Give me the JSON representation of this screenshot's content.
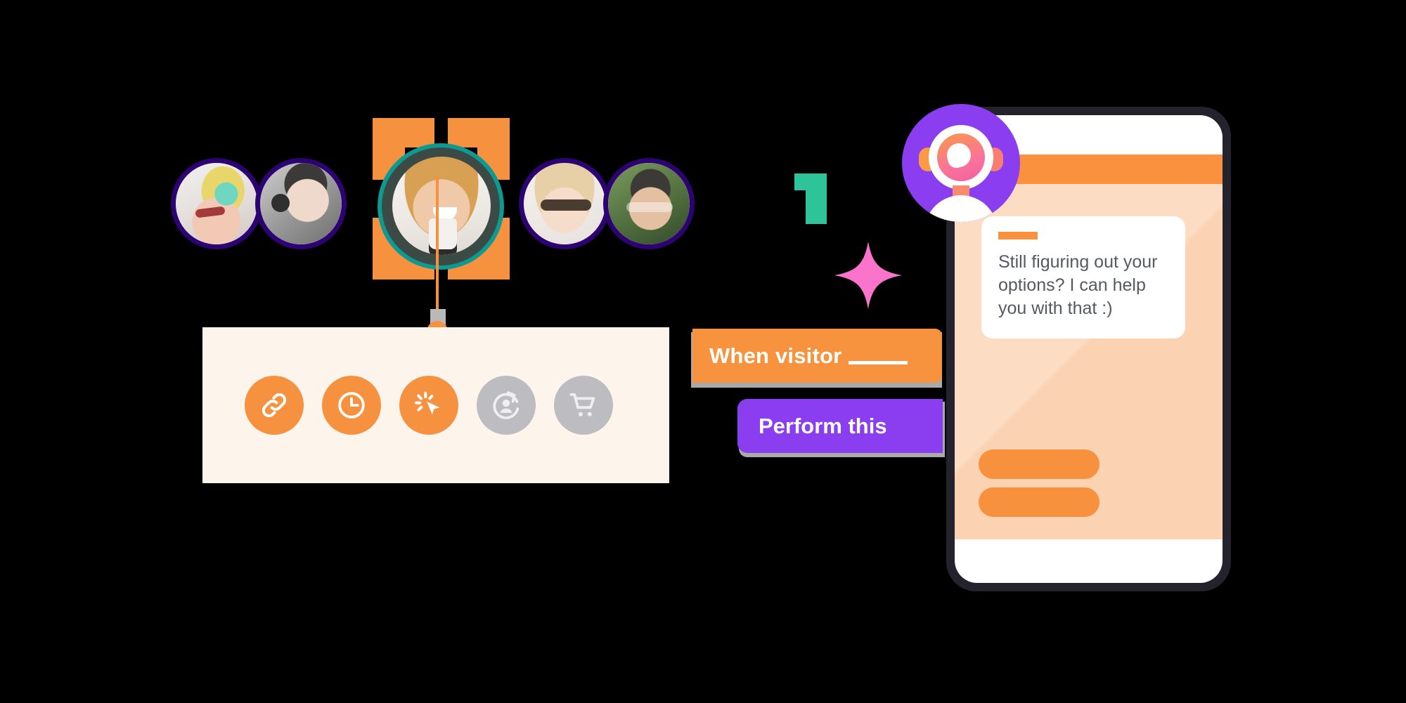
{
  "theme": {
    "background": "#000000",
    "orange": "#F7933E",
    "purple": "#8B3EF0",
    "ring_purple": "#2D0273",
    "cream": "#FDF4EC",
    "teal": "#0C9A92",
    "green": "#2EC49A",
    "pink": "#FB74CB",
    "gray_inactive": "#BDBCC0",
    "phone_frame": "#24222C",
    "chat_body": "#FBD3B2",
    "text_dark": "#555A61"
  },
  "audience": {
    "label": "visitor-avatars",
    "featured": {
      "name": "featured-visitor-avatar",
      "photo_alt": "woman laughing holding coffee cup",
      "selected": true
    },
    "avatars": [
      {
        "name": "visitor-avatar-1",
        "photo_alt": "woman with green hair and red sunglasses"
      },
      {
        "name": "visitor-avatar-2",
        "photo_alt": "man wearing headphones"
      },
      {
        "name": "visitor-avatar-4",
        "photo_alt": "blonde woman with dark sunglasses"
      },
      {
        "name": "visitor-avatar-5",
        "photo_alt": "man with glasses outdoors"
      }
    ]
  },
  "triggers": {
    "panel_label": "trigger-icon-panel",
    "items": [
      {
        "id": "link",
        "icon": "link-icon",
        "label": "Link clicked",
        "active": true
      },
      {
        "id": "time-on-site",
        "icon": "clock-icon",
        "label": "Time on site",
        "active": true
      },
      {
        "id": "click",
        "icon": "click-cursor-icon",
        "label": "Click",
        "active": true
      },
      {
        "id": "returning",
        "icon": "returning-visitor-icon",
        "label": "Returning visitor",
        "active": false
      },
      {
        "id": "cart",
        "icon": "shopping-cart-icon",
        "label": "Cart activity",
        "active": false
      }
    ]
  },
  "rule": {
    "trigger_label": "When visitor",
    "trigger_blank": "____",
    "action_label": "Perform this"
  },
  "decor": {
    "numeral": "1",
    "star": "four-point-star"
  },
  "chat": {
    "bot_avatar_name": "chatbot-avatar",
    "header_label": "",
    "message": "Still figuring out your options? I can help you with that :)",
    "quick_replies": [
      {
        "name": "quick-reply-1",
        "label": ""
      },
      {
        "name": "quick-reply-2",
        "label": ""
      }
    ]
  }
}
